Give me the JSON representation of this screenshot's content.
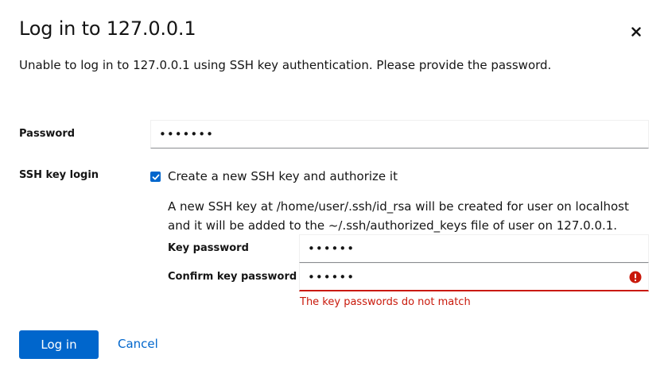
{
  "dialog": {
    "title": "Log in to 127.0.0.1",
    "close_icon": "close-icon",
    "description": "Unable to log in to 127.0.0.1 using SSH key authentication. Please provide the password."
  },
  "password": {
    "label": "Password",
    "value": "•••••••"
  },
  "ssh_key_login": {
    "label": "SSH key login",
    "checkbox_checked": true,
    "checkbox_label": "Create a new SSH key and authorize it",
    "help_text": "A new SSH key at /home/user/.ssh/id_rsa will be created for user on localhost and it will be added to the ~/.ssh/authorized_keys file of user on 127.0.0.1.",
    "key_password": {
      "label": "Key password",
      "value": "••••••"
    },
    "confirm_key_password": {
      "label": "Confirm key password",
      "value": "••••••",
      "error_icon": "exclamation-circle-icon",
      "error_message": "The key passwords do not match"
    }
  },
  "actions": {
    "login_label": "Log in",
    "cancel_label": "Cancel"
  },
  "colors": {
    "primary": "#0066cc",
    "error": "#c9190b",
    "text": "#151515"
  }
}
